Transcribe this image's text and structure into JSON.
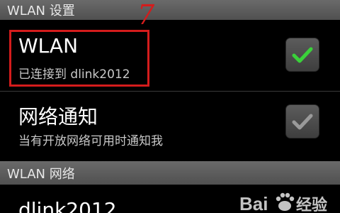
{
  "header_settings": "WLAN 设置",
  "annotation": {
    "number": "7",
    "color": "#d41c1c"
  },
  "wlan_toggle": {
    "title": "WLAN",
    "status": "已连接到 dlink2012",
    "checked": true
  },
  "network_notify": {
    "title": "网络通知",
    "description": "当有开放网络可用时通知我",
    "checked": true
  },
  "header_networks": "WLAN 网络",
  "network_list": [
    {
      "ssid": "dlink2012"
    }
  ],
  "colors": {
    "check_active": "#3ad13a",
    "check_inactive": "#9a9a9a",
    "header_bg": "#5c5c5c"
  },
  "watermark": "Baidu"
}
